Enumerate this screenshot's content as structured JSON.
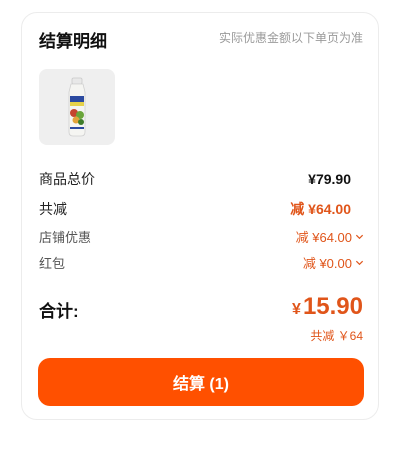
{
  "header": {
    "title": "结算明细",
    "note": "实际优惠金额以下单页为准"
  },
  "product": {
    "thumbnail_icon": "beverage-bottle-icon"
  },
  "price_rows": {
    "subtotal": {
      "label": "商品总价",
      "value": "¥79.90"
    },
    "discount_total": {
      "label": "共减",
      "value": "减 ¥64.00"
    },
    "store_discount": {
      "label": "店铺优惠",
      "value": "减 ¥64.00"
    },
    "red_packet": {
      "label": "红包",
      "value": "减 ¥0.00"
    }
  },
  "total": {
    "label": "合计:",
    "currency": "¥",
    "amount": "15.90",
    "saved": "共减 ￥64"
  },
  "checkout_button": {
    "label": "结算 (1)"
  },
  "colors": {
    "accent": "#ff5000",
    "price_orange": "#e0551a"
  }
}
